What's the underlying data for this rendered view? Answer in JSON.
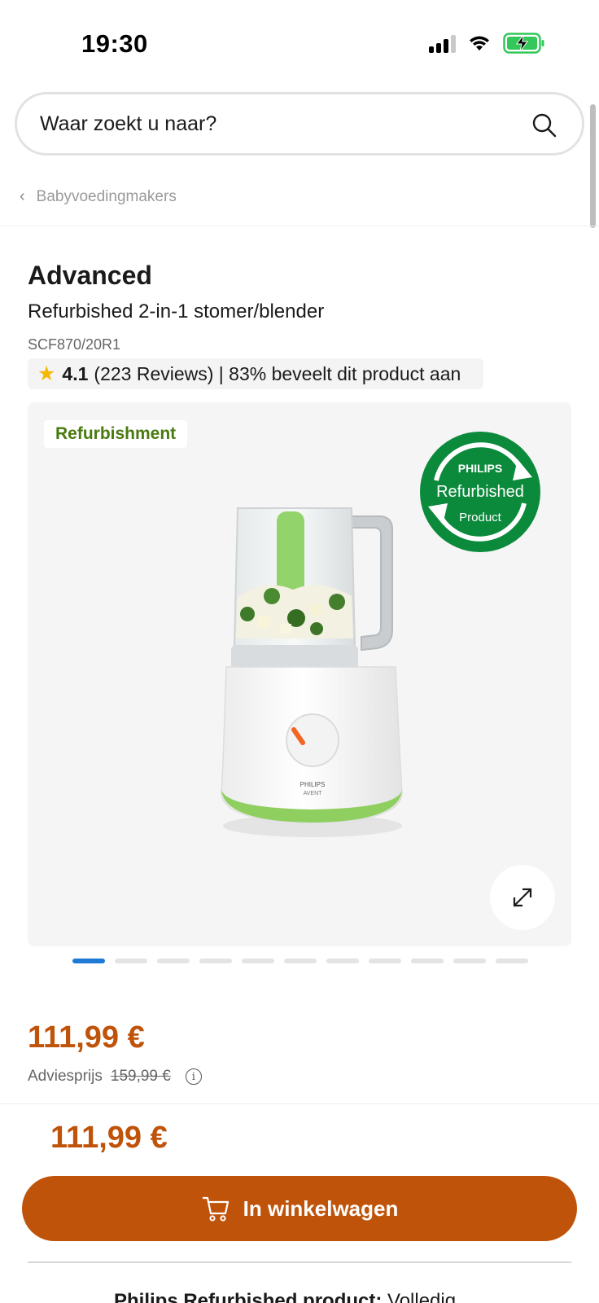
{
  "status_bar": {
    "time": "19:30"
  },
  "search": {
    "placeholder": "Waar zoekt u naar?"
  },
  "breadcrumb": {
    "label": "Babyvoedingmakers"
  },
  "product": {
    "brand": "Advanced",
    "name": "Refurbished 2-in-1 stomer/blender",
    "sku": "SCF870/20R1",
    "rating": "4.1",
    "reviews": "(223 Reviews) | 83% beveelt dit product aan"
  },
  "image": {
    "tag": "Refurbishment",
    "badge_top": "PHILIPS",
    "badge_mid": "Refurbished",
    "badge_bottom": "Product",
    "blender_brand": "PHILIPS",
    "blender_sub": "AVENT",
    "carousel_total": 11,
    "carousel_active": 1
  },
  "price": {
    "current": "111,99 €",
    "advies_label": "Adviesprijs",
    "advies_old": "159,99 €",
    "info": "i"
  },
  "sticky": {
    "price": "111,99 €",
    "cart_label": "In winkelwagen",
    "bottom_bold": "Philips Refurbished product:",
    "bottom_rest": " Volledig"
  },
  "colors": {
    "accent": "#c0530a",
    "active_dot": "#1f7ad6",
    "refurb_green": "#0b8a3c",
    "tag_green": "#4a7a10"
  }
}
